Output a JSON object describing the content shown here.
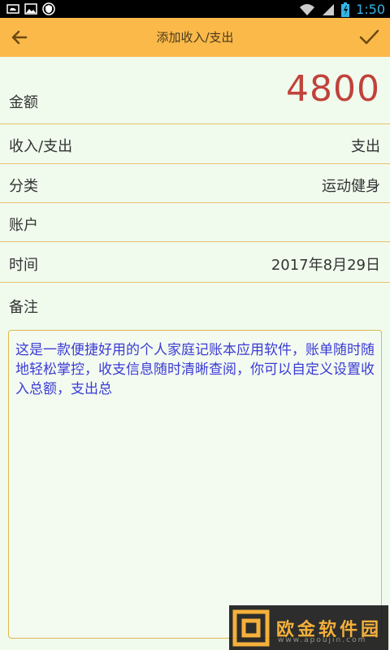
{
  "status_bar": {
    "time": "1:50"
  },
  "toolbar": {
    "title": "添加收入/支出"
  },
  "form": {
    "amount": {
      "label": "金额",
      "value": "4800"
    },
    "type": {
      "label": "收入/支出",
      "value": "支出"
    },
    "category": {
      "label": "分类",
      "value": "运动健身"
    },
    "account": {
      "label": "账户",
      "value": ""
    },
    "time": {
      "label": "时间",
      "value": "2017年8月29日"
    },
    "note": {
      "label": "备注",
      "value": "这是一款便捷好用的个人家庭记账本应用软件，账单随时随地轻松掌控，收支信息随时清晰查阅，你可以自定义设置收入总额，支出总"
    }
  },
  "watermark": {
    "name": "欧金软件园",
    "site": "www.apoujin.com"
  },
  "colors": {
    "toolbar": "#fbb94a",
    "amount": "#c0423a",
    "note_text": "#3b3bd6",
    "background": "#f0fbee"
  }
}
